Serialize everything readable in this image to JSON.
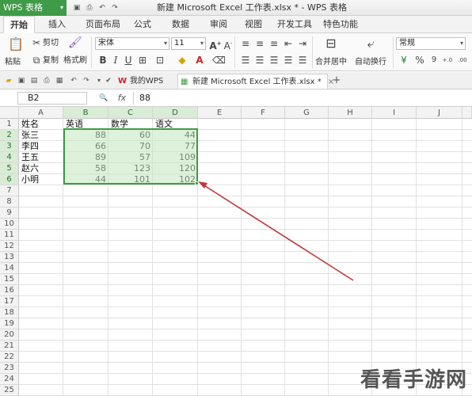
{
  "app": {
    "name": "WPS 表格",
    "window_title": "新建 Microsoft Excel 工作表.xlsx * - WPS 表格"
  },
  "tabs": [
    {
      "label": "开始",
      "active": true
    },
    {
      "label": "插入"
    },
    {
      "label": "页面布局"
    },
    {
      "label": "公式"
    },
    {
      "label": "数据"
    },
    {
      "label": "审阅"
    },
    {
      "label": "视图"
    },
    {
      "label": "开发工具"
    },
    {
      "label": "特色功能"
    }
  ],
  "ribbon": {
    "paste": "粘贴",
    "cut": "剪切",
    "copy": "复制",
    "format_painter": "格式刷",
    "font_name": "宋体",
    "font_size": "11",
    "merge_center": "合并居中",
    "wrap_text": "自动换行",
    "number_format": "常规",
    "percent": "%",
    "thousands": "9",
    "increase_decimal": "+.0",
    "decrease_decimal": ".00"
  },
  "doc_tabs": [
    {
      "label": "我的WPS"
    },
    {
      "label": "新建 Microsoft Excel 工作表.xlsx *",
      "active": true
    }
  ],
  "formula_bar": {
    "name_box": "B2",
    "fx": "fx",
    "value": "88"
  },
  "columns": [
    "A",
    "B",
    "C",
    "D",
    "E",
    "F",
    "G",
    "H",
    "I",
    "J"
  ],
  "rows": [
    "1",
    "2",
    "3",
    "4",
    "5",
    "6",
    "7",
    "8",
    "9",
    "10",
    "11",
    "12",
    "13",
    "14",
    "15",
    "16",
    "17",
    "18",
    "19",
    "20",
    "21",
    "22",
    "23",
    "24",
    "25"
  ],
  "sheet": {
    "header": [
      "姓名",
      "英语",
      "数学",
      "语文"
    ],
    "data": [
      [
        "张三",
        "88",
        "60",
        "44"
      ],
      [
        "李四",
        "66",
        "70",
        "77"
      ],
      [
        "王五",
        "89",
        "57",
        "109"
      ],
      [
        "赵六",
        "58",
        "123",
        "120"
      ],
      [
        "小明",
        "44",
        "101",
        "102"
      ]
    ]
  },
  "watermark": "看看手游网",
  "colors": {
    "accent": "#3f9b47",
    "selection": "#c3e6be",
    "arrow": "#c0393b"
  }
}
